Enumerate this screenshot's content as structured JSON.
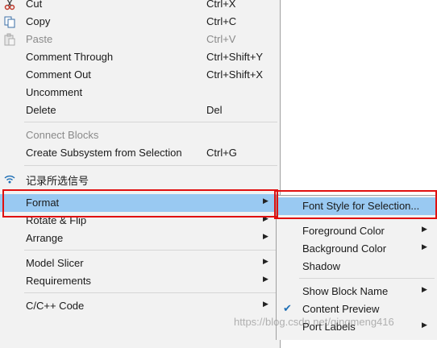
{
  "menu": {
    "cut": {
      "label": "Cut",
      "shortcut": "Ctrl+X"
    },
    "copy": {
      "label": "Copy",
      "shortcut": "Ctrl+C"
    },
    "paste": {
      "label": "Paste",
      "shortcut": "Ctrl+V"
    },
    "comment_through": {
      "label": "Comment Through",
      "shortcut": "Ctrl+Shift+Y"
    },
    "comment_out": {
      "label": "Comment Out",
      "shortcut": "Ctrl+Shift+X"
    },
    "uncomment": {
      "label": "Uncomment"
    },
    "delete": {
      "label": "Delete",
      "shortcut": "Del"
    },
    "connect_blocks": {
      "label": "Connect Blocks"
    },
    "create_subsystem": {
      "label": "Create Subsystem from Selection",
      "shortcut": "Ctrl+G"
    },
    "log_signal": {
      "label": "记录所选信号"
    },
    "format": {
      "label": "Format"
    },
    "rotate_flip": {
      "label": "Rotate & Flip"
    },
    "arrange": {
      "label": "Arrange"
    },
    "model_slicer": {
      "label": "Model Slicer"
    },
    "requirements": {
      "label": "Requirements"
    },
    "cpp_code": {
      "label": "C/C++ Code"
    }
  },
  "submenu": {
    "font_style": {
      "label": "Font Style for Selection..."
    },
    "foreground_color": {
      "label": "Foreground Color"
    },
    "background_color": {
      "label": "Background Color"
    },
    "shadow": {
      "label": "Shadow"
    },
    "show_block_name": {
      "label": "Show Block Name"
    },
    "content_preview": {
      "label": "Content Preview",
      "checked": true
    },
    "port_labels": {
      "label": "Port Labels"
    }
  },
  "glyphs": {
    "arrow": "▶",
    "check": "✔"
  },
  "watermark": "https://blog.csdn.net/qingmeng416",
  "colors": {
    "highlight": "#99c9f2",
    "annotation_box": "#e01010"
  }
}
